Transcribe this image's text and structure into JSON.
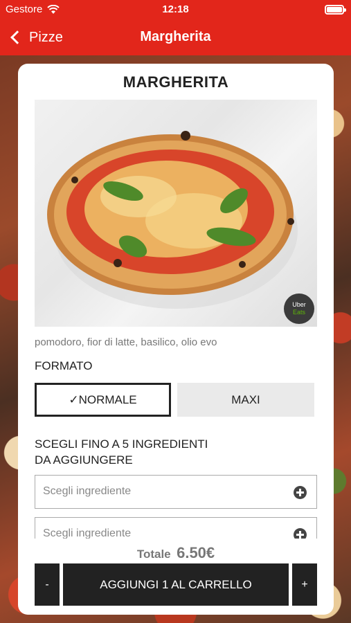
{
  "status_bar": {
    "carrier": "Gestore",
    "time": "12:18"
  },
  "nav": {
    "back_label": "Pizze",
    "title": "Margherita"
  },
  "product": {
    "name": "MARGHERITA",
    "badge": {
      "line1": "Uber",
      "line2": "Eats"
    },
    "description": "pomodoro, fior di latte, basilico, olio evo"
  },
  "format": {
    "label": "FORMATO",
    "options": [
      {
        "label": "✓NORMALE",
        "selected": true
      },
      {
        "label": "MAXI",
        "selected": false
      }
    ]
  },
  "ingredients": {
    "title_line1": "SCEGLI FINO A 5 INGREDIENTI",
    "title_line2": "DA AGGIUNGERE",
    "fields": [
      {
        "placeholder": "Scegli ingrediente"
      },
      {
        "placeholder": "Scegli ingrediente"
      }
    ]
  },
  "total": {
    "label": "Totale",
    "value": "6.50€"
  },
  "cart": {
    "minus": "-",
    "add": "AGGIUNGI 1 AL CARRELLO",
    "plus": "+"
  },
  "colors": {
    "accent": "#e2261b",
    "dark": "#222222"
  }
}
